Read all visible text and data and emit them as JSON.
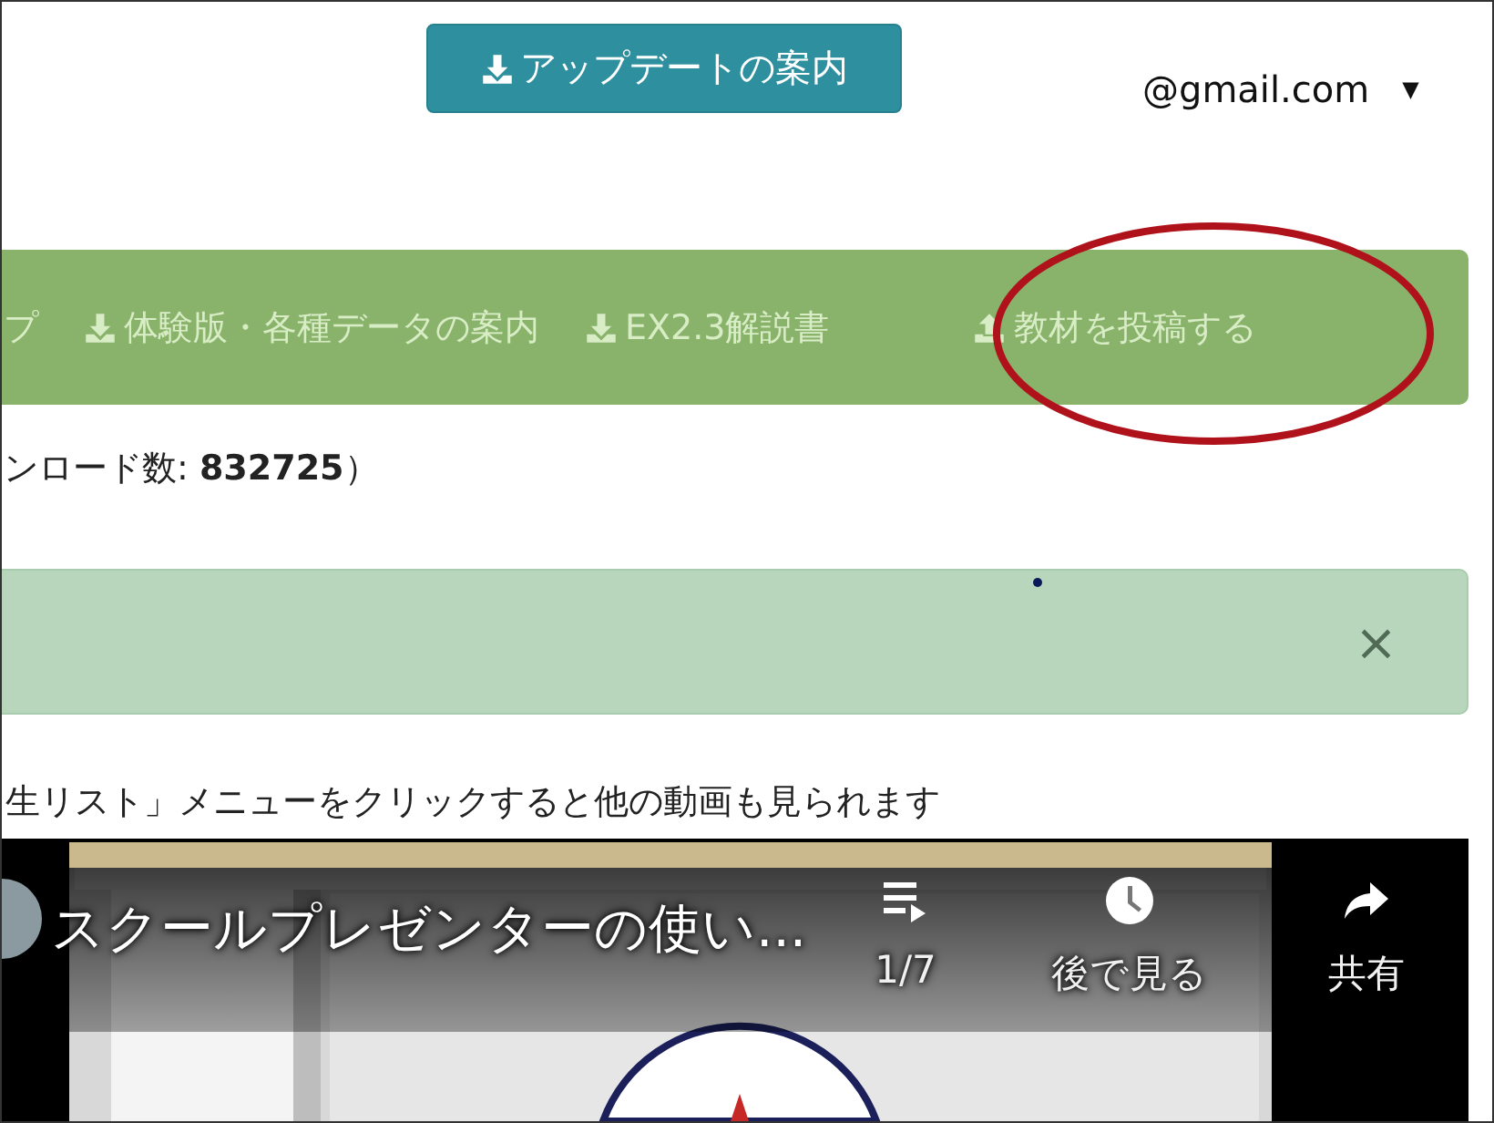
{
  "header": {
    "update_button": {
      "label": "アップデートの案内"
    },
    "account": {
      "email": "@gmail.com",
      "caret": "▼"
    }
  },
  "nav": {
    "items": [
      {
        "label": "プ",
        "kind": "text",
        "circled": false
      },
      {
        "label": "体験版・各種データの案内",
        "kind": "download",
        "circled": false
      },
      {
        "label": "EX2.3解説書",
        "kind": "download",
        "circled": false
      },
      {
        "label": "教材を投稿する",
        "kind": "upload",
        "circled": true
      }
    ]
  },
  "download_count": "ンロード数: **832725**）",
  "alert": {
    "close": "×"
  },
  "note": "生リスト」メニューをクリックすると他の動画も見られます",
  "video": {
    "title": "スクールプレゼンターの使い...",
    "actions": [
      {
        "kind": "playlist",
        "label": "1/7"
      },
      {
        "kind": "clock",
        "label": "後で見る"
      },
      {
        "kind": "share",
        "label": "共有"
      }
    ]
  }
}
